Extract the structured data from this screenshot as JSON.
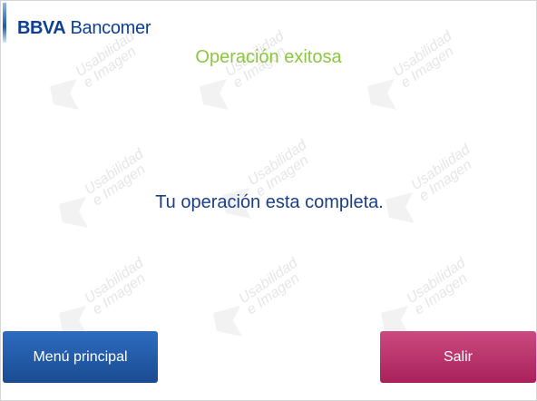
{
  "header": {
    "brand_strong": "BBVA",
    "brand_name": "Bancomer"
  },
  "main": {
    "title": "Operación exitosa",
    "message": "Tu operación esta completa."
  },
  "watermark": {
    "line1": "Usabilidad",
    "line2": "e Imagen"
  },
  "buttons": {
    "menu_label": "Menú principal",
    "exit_label": "Salir"
  },
  "colors": {
    "brand": "#0e3f91",
    "title": "#8cc63f",
    "message": "#1b3f87",
    "menu_button": "#1f5aa6",
    "exit_button": "#bb356d"
  }
}
